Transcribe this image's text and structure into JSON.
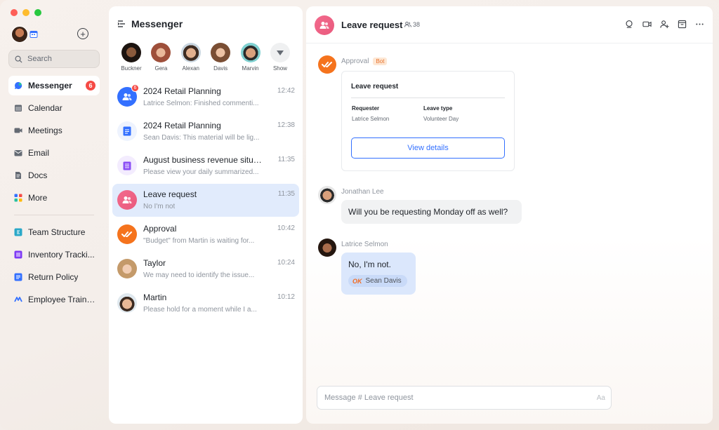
{
  "nav": {
    "search_placeholder": "Search",
    "items": [
      {
        "label": "Messenger",
        "badge": "6"
      },
      {
        "label": "Calendar"
      },
      {
        "label": "Meetings"
      },
      {
        "label": "Email"
      },
      {
        "label": "Docs"
      },
      {
        "label": "More"
      }
    ],
    "shortcuts": [
      {
        "label": "Team Structure"
      },
      {
        "label": "Inventory Tracki..."
      },
      {
        "label": "Return Policy"
      },
      {
        "label": "Employee Training"
      }
    ]
  },
  "list": {
    "title": "Messenger",
    "pinned": [
      {
        "name": "Buckner"
      },
      {
        "name": "Gera"
      },
      {
        "name": "Alexan"
      },
      {
        "name": "Davis"
      },
      {
        "name": "Marvin"
      },
      {
        "name": "Show"
      }
    ],
    "conversations": [
      {
        "name": "2024 Retail Planning",
        "preview": "Latrice Selmon: Finished commenti...",
        "time": "12:42",
        "badge": "6"
      },
      {
        "name": "2024 Retail Planning",
        "preview": "Sean Davis: This material will be lig...",
        "time": "12:38"
      },
      {
        "name": "August business revenue situa...",
        "preview": "Please view your daily summarized...",
        "time": "11:35"
      },
      {
        "name": "Leave request",
        "preview": "No I'm not",
        "time": "11:35"
      },
      {
        "name": "Approval",
        "preview": "\"Budget\" from Martin is waiting for...",
        "time": "10:42"
      },
      {
        "name": "Taylor",
        "preview": "We may need to identify the issue...",
        "time": "10:24"
      },
      {
        "name": "Martin",
        "preview": "Please hold for a moment while I a...",
        "time": "10:12"
      }
    ]
  },
  "chat": {
    "title": "Leave request",
    "member_count": "38",
    "approval": {
      "sender": "Approval",
      "tag": "Bot",
      "card_title": "Leave request",
      "requester_label": "Requester",
      "requester_value": "Latrice Selmon",
      "type_label": "Leave type",
      "type_value": "Volunteer Day",
      "button": "View details"
    },
    "msg1": {
      "sender": "Jonathan Lee",
      "text": "Will you be requesting Monday off as well?"
    },
    "msg2": {
      "sender": "Latrice Selmon",
      "text": "No, I'm not.",
      "reaction_emoji": "OK",
      "reaction_user": "Sean Davis"
    },
    "composer_placeholder": "Message # Leave request",
    "composer_format": "Aa"
  }
}
